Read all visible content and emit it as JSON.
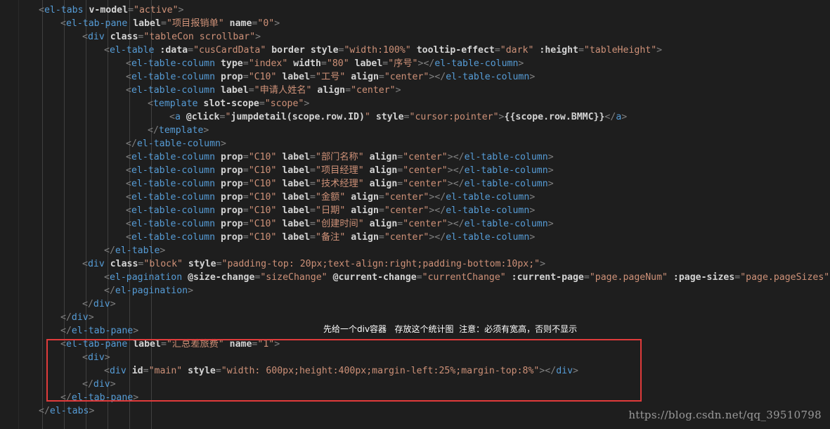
{
  "code_lines": [
    [
      {
        "t": "t",
        "v": "<"
      },
      {
        "t": "tag",
        "v": "el-tabs"
      },
      {
        "t": "attr",
        "v": " v-model"
      },
      {
        "t": "t",
        "v": "="
      },
      {
        "t": "val",
        "v": "\"active\""
      },
      {
        "t": "t",
        "v": ">"
      }
    ],
    [
      {
        "t": "t",
        "v": "<"
      },
      {
        "t": "tag",
        "v": "el-tab-pane"
      },
      {
        "t": "attr",
        "v": " label"
      },
      {
        "t": "t",
        "v": "="
      },
      {
        "t": "val",
        "v": "\"项目报销单\""
      },
      {
        "t": "attr",
        "v": " name"
      },
      {
        "t": "t",
        "v": "="
      },
      {
        "t": "val",
        "v": "\"0\""
      },
      {
        "t": "t",
        "v": ">"
      }
    ],
    [
      {
        "t": "t",
        "v": "<"
      },
      {
        "t": "tag",
        "v": "div"
      },
      {
        "t": "attr",
        "v": " class"
      },
      {
        "t": "t",
        "v": "="
      },
      {
        "t": "val",
        "v": "\"tableCon scrollbar\""
      },
      {
        "t": "t",
        "v": ">"
      }
    ],
    [
      {
        "t": "t",
        "v": "<"
      },
      {
        "t": "tag",
        "v": "el-table"
      },
      {
        "t": "attr",
        "v": " :data"
      },
      {
        "t": "t",
        "v": "="
      },
      {
        "t": "val",
        "v": "\"cusCardData\""
      },
      {
        "t": "attr",
        "v": " border"
      },
      {
        "t": "attr",
        "v": " style"
      },
      {
        "t": "t",
        "v": "="
      },
      {
        "t": "val",
        "v": "\"width:100%\""
      },
      {
        "t": "attr",
        "v": " tooltip-effect"
      },
      {
        "t": "t",
        "v": "="
      },
      {
        "t": "val",
        "v": "\"dark\""
      },
      {
        "t": "attr",
        "v": " :height"
      },
      {
        "t": "t",
        "v": "="
      },
      {
        "t": "val",
        "v": "\"tableHeight\""
      },
      {
        "t": "t",
        "v": ">"
      }
    ],
    [
      {
        "t": "t",
        "v": "<"
      },
      {
        "t": "tag",
        "v": "el-table-column"
      },
      {
        "t": "attr",
        "v": " type"
      },
      {
        "t": "t",
        "v": "="
      },
      {
        "t": "val",
        "v": "\"index\""
      },
      {
        "t": "attr",
        "v": " width"
      },
      {
        "t": "t",
        "v": "="
      },
      {
        "t": "val",
        "v": "\"80\""
      },
      {
        "t": "attr",
        "v": " label"
      },
      {
        "t": "t",
        "v": "="
      },
      {
        "t": "val",
        "v": "\"序号\""
      },
      {
        "t": "t",
        "v": "></"
      },
      {
        "t": "tag",
        "v": "el-table-column"
      },
      {
        "t": "t",
        "v": ">"
      }
    ],
    [
      {
        "t": "t",
        "v": "<"
      },
      {
        "t": "tag",
        "v": "el-table-column"
      },
      {
        "t": "attr",
        "v": " prop"
      },
      {
        "t": "t",
        "v": "="
      },
      {
        "t": "val",
        "v": "\"C10\""
      },
      {
        "t": "attr",
        "v": " label"
      },
      {
        "t": "t",
        "v": "="
      },
      {
        "t": "val",
        "v": "\"工号\""
      },
      {
        "t": "attr",
        "v": " align"
      },
      {
        "t": "t",
        "v": "="
      },
      {
        "t": "val",
        "v": "\"center\""
      },
      {
        "t": "t",
        "v": "></"
      },
      {
        "t": "tag",
        "v": "el-table-column"
      },
      {
        "t": "t",
        "v": ">"
      }
    ],
    [
      {
        "t": "t",
        "v": "<"
      },
      {
        "t": "tag",
        "v": "el-table-column"
      },
      {
        "t": "attr",
        "v": " label"
      },
      {
        "t": "t",
        "v": "="
      },
      {
        "t": "val",
        "v": "\"申请人姓名\""
      },
      {
        "t": "attr",
        "v": " align"
      },
      {
        "t": "t",
        "v": "="
      },
      {
        "t": "val",
        "v": "\"center\""
      },
      {
        "t": "t",
        "v": ">"
      }
    ],
    [
      {
        "t": "t",
        "v": "<"
      },
      {
        "t": "tag",
        "v": "template"
      },
      {
        "t": "attr",
        "v": " slot-scope"
      },
      {
        "t": "t",
        "v": "="
      },
      {
        "t": "val",
        "v": "\"scope\""
      },
      {
        "t": "t",
        "v": ">"
      }
    ],
    [
      {
        "t": "t",
        "v": "<"
      },
      {
        "t": "tag",
        "v": "a"
      },
      {
        "t": "attr",
        "v": " @click"
      },
      {
        "t": "t",
        "v": "="
      },
      {
        "t": "val",
        "v": "\""
      },
      {
        "t": "mustache",
        "v": "jumpdetail(scope.row.ID)"
      },
      {
        "t": "val",
        "v": "\""
      },
      {
        "t": "attr",
        "v": " style"
      },
      {
        "t": "t",
        "v": "="
      },
      {
        "t": "val",
        "v": "\"cursor:pointer\""
      },
      {
        "t": "t",
        "v": ">"
      },
      {
        "t": "mustache",
        "v": "{{scope.row.BMMC}}"
      },
      {
        "t": "t",
        "v": "</"
      },
      {
        "t": "tag",
        "v": "a"
      },
      {
        "t": "t",
        "v": ">"
      }
    ],
    [
      {
        "t": "t",
        "v": "</"
      },
      {
        "t": "tag",
        "v": "template"
      },
      {
        "t": "t",
        "v": ">"
      }
    ],
    [
      {
        "t": "t",
        "v": "</"
      },
      {
        "t": "tag",
        "v": "el-table-column"
      },
      {
        "t": "t",
        "v": ">"
      }
    ],
    [
      {
        "t": "t",
        "v": "<"
      },
      {
        "t": "tag",
        "v": "el-table-column"
      },
      {
        "t": "attr",
        "v": " prop"
      },
      {
        "t": "t",
        "v": "="
      },
      {
        "t": "val",
        "v": "\"C10\""
      },
      {
        "t": "attr",
        "v": " label"
      },
      {
        "t": "t",
        "v": "="
      },
      {
        "t": "val",
        "v": "\"部门名称\""
      },
      {
        "t": "attr",
        "v": " align"
      },
      {
        "t": "t",
        "v": "="
      },
      {
        "t": "val",
        "v": "\"center\""
      },
      {
        "t": "t",
        "v": "></"
      },
      {
        "t": "tag",
        "v": "el-table-column"
      },
      {
        "t": "t",
        "v": ">"
      }
    ],
    [
      {
        "t": "t",
        "v": "<"
      },
      {
        "t": "tag",
        "v": "el-table-column"
      },
      {
        "t": "attr",
        "v": " prop"
      },
      {
        "t": "t",
        "v": "="
      },
      {
        "t": "val",
        "v": "\"C10\""
      },
      {
        "t": "attr",
        "v": " label"
      },
      {
        "t": "t",
        "v": "="
      },
      {
        "t": "val",
        "v": "\"项目经理\""
      },
      {
        "t": "attr",
        "v": " align"
      },
      {
        "t": "t",
        "v": "="
      },
      {
        "t": "val",
        "v": "\"center\""
      },
      {
        "t": "t",
        "v": "></"
      },
      {
        "t": "tag",
        "v": "el-table-column"
      },
      {
        "t": "t",
        "v": ">"
      }
    ],
    [
      {
        "t": "t",
        "v": "<"
      },
      {
        "t": "tag",
        "v": "el-table-column"
      },
      {
        "t": "attr",
        "v": " prop"
      },
      {
        "t": "t",
        "v": "="
      },
      {
        "t": "val",
        "v": "\"C10\""
      },
      {
        "t": "attr",
        "v": " label"
      },
      {
        "t": "t",
        "v": "="
      },
      {
        "t": "val",
        "v": "\"技术经理\""
      },
      {
        "t": "attr",
        "v": " align"
      },
      {
        "t": "t",
        "v": "="
      },
      {
        "t": "val",
        "v": "\"center\""
      },
      {
        "t": "t",
        "v": "></"
      },
      {
        "t": "tag",
        "v": "el-table-column"
      },
      {
        "t": "t",
        "v": ">"
      }
    ],
    [
      {
        "t": "t",
        "v": "<"
      },
      {
        "t": "tag",
        "v": "el-table-column"
      },
      {
        "t": "attr",
        "v": " prop"
      },
      {
        "t": "t",
        "v": "="
      },
      {
        "t": "val",
        "v": "\"C10\""
      },
      {
        "t": "attr",
        "v": " label"
      },
      {
        "t": "t",
        "v": "="
      },
      {
        "t": "val",
        "v": "\"金额\""
      },
      {
        "t": "attr",
        "v": " align"
      },
      {
        "t": "t",
        "v": "="
      },
      {
        "t": "val",
        "v": "\"center\""
      },
      {
        "t": "t",
        "v": "></"
      },
      {
        "t": "tag",
        "v": "el-table-column"
      },
      {
        "t": "t",
        "v": ">"
      }
    ],
    [
      {
        "t": "t",
        "v": "<"
      },
      {
        "t": "tag",
        "v": "el-table-column"
      },
      {
        "t": "attr",
        "v": " prop"
      },
      {
        "t": "t",
        "v": "="
      },
      {
        "t": "val",
        "v": "\"C10\""
      },
      {
        "t": "attr",
        "v": " label"
      },
      {
        "t": "t",
        "v": "="
      },
      {
        "t": "val",
        "v": "\"日期\""
      },
      {
        "t": "attr",
        "v": " align"
      },
      {
        "t": "t",
        "v": "="
      },
      {
        "t": "val",
        "v": "\"center\""
      },
      {
        "t": "t",
        "v": "></"
      },
      {
        "t": "tag",
        "v": "el-table-column"
      },
      {
        "t": "t",
        "v": ">"
      }
    ],
    [
      {
        "t": "t",
        "v": "<"
      },
      {
        "t": "tag",
        "v": "el-table-column"
      },
      {
        "t": "attr",
        "v": " prop"
      },
      {
        "t": "t",
        "v": "="
      },
      {
        "t": "val",
        "v": "\"C10\""
      },
      {
        "t": "attr",
        "v": " label"
      },
      {
        "t": "t",
        "v": "="
      },
      {
        "t": "val",
        "v": "\"创建时间\""
      },
      {
        "t": "attr",
        "v": " align"
      },
      {
        "t": "t",
        "v": "="
      },
      {
        "t": "val",
        "v": "\"center\""
      },
      {
        "t": "t",
        "v": "></"
      },
      {
        "t": "tag",
        "v": "el-table-column"
      },
      {
        "t": "t",
        "v": ">"
      }
    ],
    [
      {
        "t": "t",
        "v": "<"
      },
      {
        "t": "tag",
        "v": "el-table-column"
      },
      {
        "t": "attr",
        "v": " prop"
      },
      {
        "t": "t",
        "v": "="
      },
      {
        "t": "val",
        "v": "\"C10\""
      },
      {
        "t": "attr",
        "v": " label"
      },
      {
        "t": "t",
        "v": "="
      },
      {
        "t": "val",
        "v": "\"备注\""
      },
      {
        "t": "attr",
        "v": " align"
      },
      {
        "t": "t",
        "v": "="
      },
      {
        "t": "val",
        "v": "\"center\""
      },
      {
        "t": "t",
        "v": "></"
      },
      {
        "t": "tag",
        "v": "el-table-column"
      },
      {
        "t": "t",
        "v": ">"
      }
    ],
    [
      {
        "t": "t",
        "v": "</"
      },
      {
        "t": "tag",
        "v": "el-table"
      },
      {
        "t": "t",
        "v": ">"
      }
    ],
    [
      {
        "t": "t",
        "v": "<"
      },
      {
        "t": "tag",
        "v": "div"
      },
      {
        "t": "attr",
        "v": " class"
      },
      {
        "t": "t",
        "v": "="
      },
      {
        "t": "val",
        "v": "\"block\""
      },
      {
        "t": "attr",
        "v": " style"
      },
      {
        "t": "t",
        "v": "="
      },
      {
        "t": "val",
        "v": "\"padding-top: 20px;text-align:right;padding-bottom:10px;\""
      },
      {
        "t": "t",
        "v": ">"
      }
    ],
    [
      {
        "t": "t",
        "v": "<"
      },
      {
        "t": "tag",
        "v": "el-pagination"
      },
      {
        "t": "attr",
        "v": " @size-change"
      },
      {
        "t": "t",
        "v": "="
      },
      {
        "t": "val",
        "v": "\"sizeChange\""
      },
      {
        "t": "attr",
        "v": " @current-change"
      },
      {
        "t": "t",
        "v": "="
      },
      {
        "t": "val",
        "v": "\"currentChange\""
      },
      {
        "t": "attr",
        "v": " :current-page"
      },
      {
        "t": "t",
        "v": "="
      },
      {
        "t": "val",
        "v": "\"page.pageNum\""
      },
      {
        "t": "attr",
        "v": " :page-sizes"
      },
      {
        "t": "t",
        "v": "="
      },
      {
        "t": "val",
        "v": "\"page.pageSizes\""
      },
      {
        "t": "attr",
        "v": " :pag"
      }
    ],
    [
      {
        "t": "t",
        "v": "</"
      },
      {
        "t": "tag",
        "v": "el-pagination"
      },
      {
        "t": "t",
        "v": ">"
      }
    ],
    [
      {
        "t": "t",
        "v": "</"
      },
      {
        "t": "tag",
        "v": "div"
      },
      {
        "t": "t",
        "v": ">"
      }
    ],
    [
      {
        "t": "t",
        "v": "</"
      },
      {
        "t": "tag",
        "v": "div"
      },
      {
        "t": "t",
        "v": ">"
      }
    ],
    [
      {
        "t": "t",
        "v": "</"
      },
      {
        "t": "tag",
        "v": "el-tab-pane"
      },
      {
        "t": "t",
        "v": ">"
      }
    ],
    [
      {
        "t": "t",
        "v": "<"
      },
      {
        "t": "tag",
        "v": "el-tab-pane"
      },
      {
        "t": "attr",
        "v": " label"
      },
      {
        "t": "t",
        "v": "="
      },
      {
        "t": "val",
        "v": "\"汇总差旅费\""
      },
      {
        "t": "attr",
        "v": " name"
      },
      {
        "t": "t",
        "v": "="
      },
      {
        "t": "val",
        "v": "\"1\""
      },
      {
        "t": "t",
        "v": ">"
      }
    ],
    [
      {
        "t": "t",
        "v": "<"
      },
      {
        "t": "tag",
        "v": "div"
      },
      {
        "t": "t",
        "v": ">"
      }
    ],
    [
      {
        "t": "t",
        "v": "<"
      },
      {
        "t": "tag",
        "v": "div"
      },
      {
        "t": "attr",
        "v": " id"
      },
      {
        "t": "t",
        "v": "="
      },
      {
        "t": "val",
        "v": "\"main\""
      },
      {
        "t": "attr",
        "v": " style"
      },
      {
        "t": "t",
        "v": "="
      },
      {
        "t": "val",
        "v": "\"width: 600px;height:400px;margin-left:25%;margin-top:8%\""
      },
      {
        "t": "t",
        "v": "></"
      },
      {
        "t": "tag",
        "v": "div"
      },
      {
        "t": "t",
        "v": ">"
      }
    ],
    [
      {
        "t": "t",
        "v": "</"
      },
      {
        "t": "tag",
        "v": "div"
      },
      {
        "t": "t",
        "v": ">"
      }
    ],
    [
      {
        "t": "t",
        "v": "</"
      },
      {
        "t": "tag",
        "v": "el-tab-pane"
      },
      {
        "t": "t",
        "v": ">"
      }
    ],
    [
      {
        "t": "t",
        "v": "</"
      },
      {
        "t": "tag",
        "v": "el-tabs"
      },
      {
        "t": "t",
        "v": ">"
      }
    ]
  ],
  "annotation_text": "先给一个div容器   存放这个统计图  注意：必须有宽高，否则不显示",
  "watermark_text": "https://blog.csdn.net/qq_39510798",
  "colors": {
    "background": "#1e1e1e",
    "tag": "#569cd6",
    "attribute": "#d4d4d4",
    "string": "#ce9178",
    "punctuation": "#808080",
    "highlight_border": "#e03b3b"
  }
}
